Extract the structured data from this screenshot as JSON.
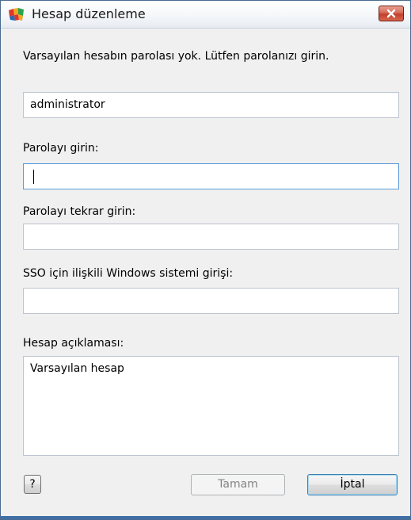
{
  "window": {
    "title": "Hesap düzenleme"
  },
  "dialog": {
    "message": "Varsayılan hesabın parolası yok. Lütfen parolanızı girin.",
    "account_name_value": "administrator",
    "password_label": "Parolayı girin:",
    "password_value": "",
    "password_confirm_label": "Parolayı tekrar girin:",
    "password_confirm_value": "",
    "sso_label": "SSO için ilişkili Windows sistemi girişi:",
    "sso_value": "",
    "description_label": "Hesap açıklaması:",
    "description_value": "Varsayılan hesap"
  },
  "buttons": {
    "help_label": "?",
    "ok_label": "Tamam",
    "ok_disabled": true,
    "cancel_label": "İptal"
  },
  "icons": {
    "app": "avg-logo-icon",
    "close": "close-icon"
  },
  "colors": {
    "close_button": "#c2402b",
    "focus_border": "#5a9bd6",
    "window_border": "#4a6a8f"
  }
}
